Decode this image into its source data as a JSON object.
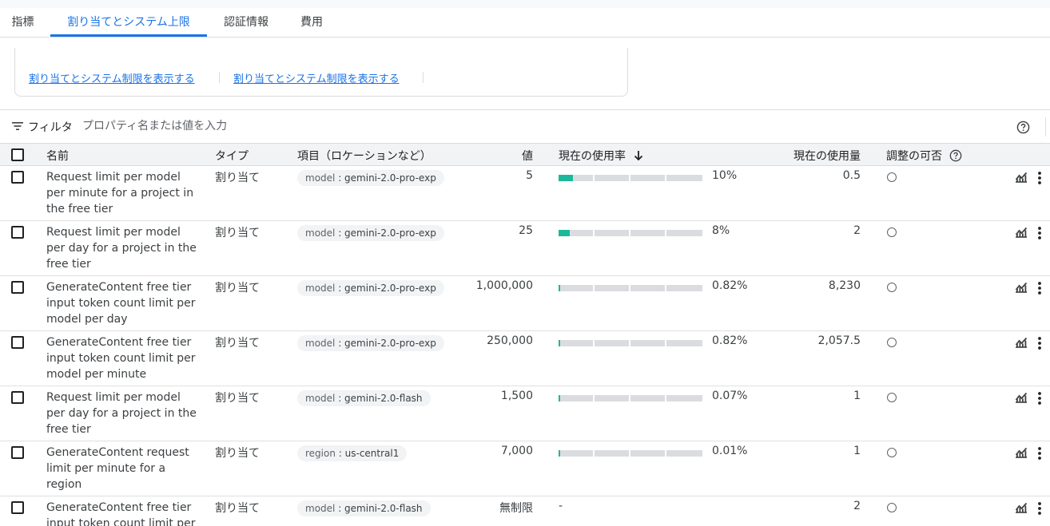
{
  "tabs": [
    {
      "label": "指標"
    },
    {
      "label": "割り当てとシステム上限",
      "active": true
    },
    {
      "label": "認証情報"
    },
    {
      "label": "費用"
    }
  ],
  "card": {
    "link1": "割り当てとシステム制限を表示する",
    "link2": "割り当てとシステム制限を表示する"
  },
  "filter": {
    "label": "フィルタ",
    "placeholder": "プロパティ名または値を入力"
  },
  "columns": {
    "name": "名前",
    "type": "タイプ",
    "dimension": "項目（ロケーションなど）",
    "value": "値",
    "usage_rate": "現在の使用率",
    "usage": "現在の使用量",
    "adjustable": "調整の可否"
  },
  "accent_color": "#1a73e8",
  "bar_color": "#1bb99a",
  "rows": [
    {
      "name": "Request limit per model per minute for a project in the free tier",
      "type": "割り当て",
      "chip_key": "model",
      "chip_value": "gemini-2.0-pro-exp",
      "value": "5",
      "percent": "10%",
      "fill_fraction": 0.1,
      "usage": "0.5"
    },
    {
      "name": "Request limit per model per day for a project in the free tier",
      "type": "割り当て",
      "chip_key": "model",
      "chip_value": "gemini-2.0-pro-exp",
      "value": "25",
      "percent": "8%",
      "fill_fraction": 0.08,
      "usage": "2"
    },
    {
      "name": "GenerateContent free tier input token count limit per model per day",
      "type": "割り当て",
      "chip_key": "model",
      "chip_value": "gemini-2.0-pro-exp",
      "value": "1,000,000",
      "percent": "0.82%",
      "fill_fraction": 0.0082,
      "usage": "8,230"
    },
    {
      "name": "GenerateContent free tier input token count limit per model per minute",
      "type": "割り当て",
      "chip_key": "model",
      "chip_value": "gemini-2.0-pro-exp",
      "value": "250,000",
      "percent": "0.82%",
      "fill_fraction": 0.0082,
      "usage": "2,057.5"
    },
    {
      "name": "Request limit per model per day for a project in the free tier",
      "type": "割り当て",
      "chip_key": "model",
      "chip_value": "gemini-2.0-flash",
      "value": "1,500",
      "percent": "0.07%",
      "fill_fraction": 0.0007,
      "usage": "1"
    },
    {
      "name": "GenerateContent request limit per minute for a region",
      "type": "割り当て",
      "chip_key": "region",
      "chip_value": "us-central1",
      "value": "7,000",
      "percent": "0.01%",
      "fill_fraction": 0.0001,
      "usage": "1"
    },
    {
      "name": "GenerateContent free tier input token count limit per model per day",
      "type": "割り当て",
      "chip_key": "model",
      "chip_value": "gemini-2.0-flash",
      "value": "無制限",
      "percent": "-",
      "fill_fraction": null,
      "usage": "2"
    }
  ]
}
